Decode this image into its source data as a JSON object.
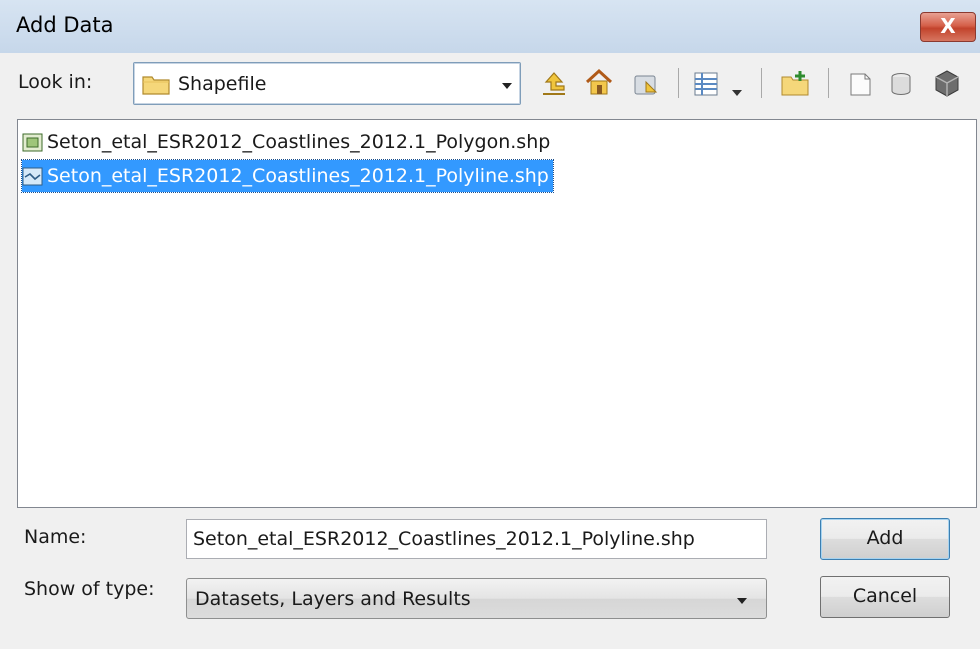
{
  "window": {
    "title": "Add Data",
    "close_label": "X"
  },
  "look_in": {
    "label": "Look in:",
    "value": "Shapefile"
  },
  "toolbar": {
    "icons": [
      "up-one-level-icon",
      "home-icon",
      "connect-folder-icon",
      "view-menu-icon",
      "view-dropdown-icon",
      "new-folder-icon",
      "new-file-icon",
      "new-database-icon",
      "new-dataset-icon"
    ]
  },
  "files": [
    {
      "name": "Seton_etal_ESR2012_Coastlines_2012.1_Polygon.shp",
      "type": "polygon-shapefile-icon",
      "selected": false
    },
    {
      "name": "Seton_etal_ESR2012_Coastlines_2012.1_Polyline.shp",
      "type": "polyline-shapefile-icon",
      "selected": true
    }
  ],
  "name_field": {
    "label": "Name:",
    "value": "Seton_etal_ESR2012_Coastlines_2012.1_Polyline.shp"
  },
  "type_field": {
    "label": "Show of type:",
    "value": "Datasets, Layers and Results"
  },
  "buttons": {
    "add": "Add",
    "cancel": "Cancel"
  },
  "colors": {
    "selection": "#3399ff",
    "titlebar": "#c6d7ea",
    "close": "#c2432c"
  }
}
